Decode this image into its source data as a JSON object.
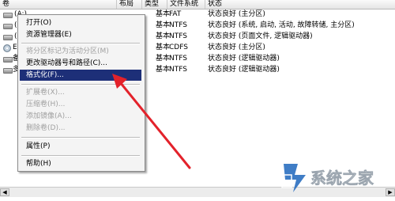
{
  "header": {
    "col_volume": "卷",
    "col_layout": "布局",
    "col_type": "类型",
    "col_fs": "文件系统",
    "col_status": "状态"
  },
  "rows": [
    {
      "name": "(A:)",
      "layout": "",
      "type": "基本",
      "fs": "FAT",
      "status": "状态良好 (主分区)"
    },
    {
      "name": "(C:)",
      "layout": "",
      "type": "基本",
      "fs": "NTFS",
      "status": "状态良好 (系统, 启动, 活动, 故障转储, 主分区)"
    },
    {
      "name": "(D:)",
      "layout": "",
      "type": "基本",
      "fs": "NTFS",
      "status": "状态良好 (页面文件, 逻辑驱动器)"
    },
    {
      "name": "Excel",
      "layout": "",
      "type": "基本",
      "fs": "CDFS",
      "status": "状态良好 (主分区)"
    },
    {
      "name": "备份文",
      "layout": "",
      "type": "基本",
      "fs": "NTFS",
      "status": "状态良好 (逻辑驱动器)"
    },
    {
      "name": "多媒体",
      "layout": "",
      "type": "基本",
      "fs": "NTFS",
      "status": "状态良好 (逻辑驱动器)"
    }
  ],
  "menu": {
    "open": "打开(O)",
    "explorer": "资源管理器(E)",
    "mark_active": "将分区标记为活动分区(M)",
    "change_letter": "更改驱动器号和路径(C)...",
    "format": "格式化(F)...",
    "extend": "扩展卷(X)...",
    "shrink": "压缩卷(H)...",
    "add_mirror": "添加镜像(A)...",
    "delete": "删除卷(D)...",
    "properties": "属性(P)",
    "help": "帮助(H)"
  },
  "watermark": {
    "text": "系统之家"
  },
  "colors": {
    "selection": "#1d2f78",
    "arrow": "#e3222b"
  }
}
